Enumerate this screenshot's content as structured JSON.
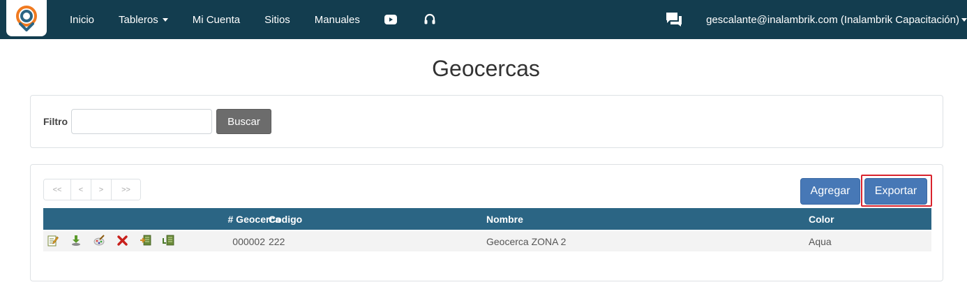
{
  "nav": {
    "items": [
      {
        "label": "Inicio"
      },
      {
        "label": "Tableros"
      },
      {
        "label": "Mi Cuenta"
      },
      {
        "label": "Sitios"
      },
      {
        "label": "Manuales"
      }
    ],
    "icons": [
      "youtube-icon",
      "headset-icon",
      "chat-icon"
    ],
    "user": "gescalante@inalambrik.com (Inalambrik Capacitación)"
  },
  "page": {
    "title": "Geocercas"
  },
  "filter": {
    "label": "Filtro",
    "value": "",
    "search_label": "Buscar"
  },
  "pager": {
    "first": "<<",
    "prev": "<",
    "next": ">",
    "last": ">>"
  },
  "toolbar": {
    "add_label": "Agregar",
    "export_label": "Exportar"
  },
  "table": {
    "headers": [
      "",
      "# Geocerca",
      "Codigo",
      "Nombre",
      "Color"
    ],
    "rows": [
      {
        "actions": [
          "edit-icon",
          "download-icon",
          "paint-icon",
          "delete-icon",
          "export-icon",
          "import-icon"
        ],
        "num": "000002",
        "code": "222",
        "name": "Geocerca ZONA 2",
        "color": "Aqua"
      }
    ]
  },
  "colors": {
    "navbar": "#133d4f",
    "table_header": "#2b6584",
    "primary_button": "#4778b6",
    "secondary_button": "#6c6c6c",
    "highlight": "#d9232d"
  }
}
